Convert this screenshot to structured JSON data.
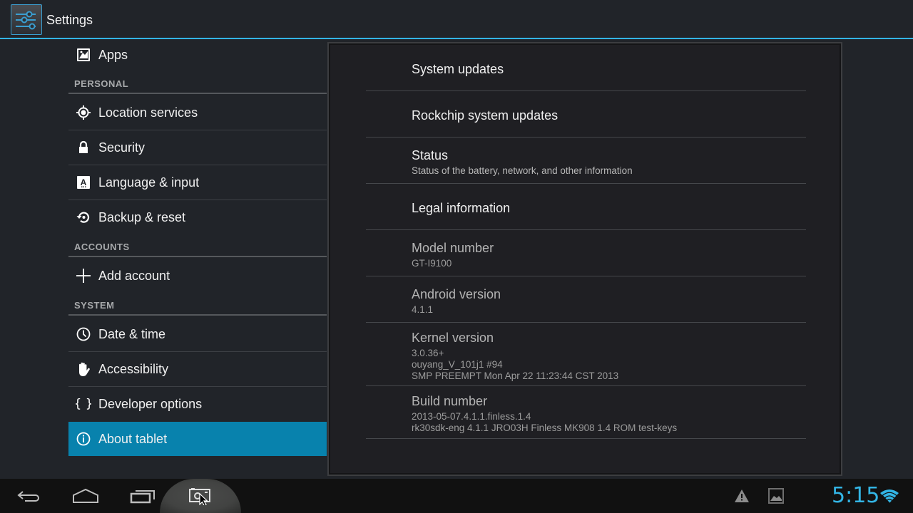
{
  "action_bar": {
    "title": "Settings",
    "icon": "settings-sliders-icon",
    "accent_color": "#33b5e5"
  },
  "sidebar": {
    "top_items": [
      {
        "label": "Apps",
        "icon": "apps-icon"
      }
    ],
    "sections": [
      {
        "header": "PERSONAL",
        "items": [
          {
            "label": "Location services",
            "icon": "location-icon"
          },
          {
            "label": "Security",
            "icon": "lock-icon"
          },
          {
            "label": "Language & input",
            "icon": "language-icon"
          },
          {
            "label": "Backup & reset",
            "icon": "backup-icon"
          }
        ]
      },
      {
        "header": "ACCOUNTS",
        "items": [
          {
            "label": "Add account",
            "icon": "plus-icon"
          }
        ]
      },
      {
        "header": "SYSTEM",
        "items": [
          {
            "label": "Date & time",
            "icon": "clock-icon"
          },
          {
            "label": "Accessibility",
            "icon": "hand-icon"
          },
          {
            "label": "Developer options",
            "icon": "braces-icon"
          },
          {
            "label": "About tablet",
            "icon": "info-icon",
            "selected": true
          }
        ]
      }
    ],
    "selected_color": "#0882ad"
  },
  "about": {
    "items": [
      {
        "title": "System updates"
      },
      {
        "title": "Rockchip system updates"
      },
      {
        "title": "Status",
        "summary": [
          "Status of the battery, network, and other information"
        ]
      },
      {
        "title": "Legal information"
      },
      {
        "title": "Model number",
        "summary": [
          "GT-I9100"
        ]
      },
      {
        "title": "Android version",
        "summary": [
          "4.1.1"
        ]
      },
      {
        "title": "Kernel version",
        "summary": [
          "3.0.36+",
          "ouyang_V_101j1 #94",
          "SMP PREEMPT Mon Apr 22 11:23:44 CST 2013"
        ]
      },
      {
        "title": "Build number",
        "summary": [
          "2013-05-07.4.1.1.finless.1.4",
          "rk30sdk-eng 4.1.1 JRO03H Finless MK908 1.4 ROM test-keys"
        ]
      }
    ]
  },
  "system_bar": {
    "buttons": [
      {
        "name": "back",
        "icon": "back-icon"
      },
      {
        "name": "home",
        "icon": "home-icon"
      },
      {
        "name": "recents",
        "icon": "recent-apps-icon"
      },
      {
        "name": "screenshot",
        "icon": "screenshot-icon"
      }
    ],
    "notifications": [
      {
        "icon": "warning-icon"
      },
      {
        "icon": "image-icon"
      }
    ],
    "clock": "5:15",
    "wifi": "wifi-icon",
    "clock_color": "#33b5e5"
  }
}
